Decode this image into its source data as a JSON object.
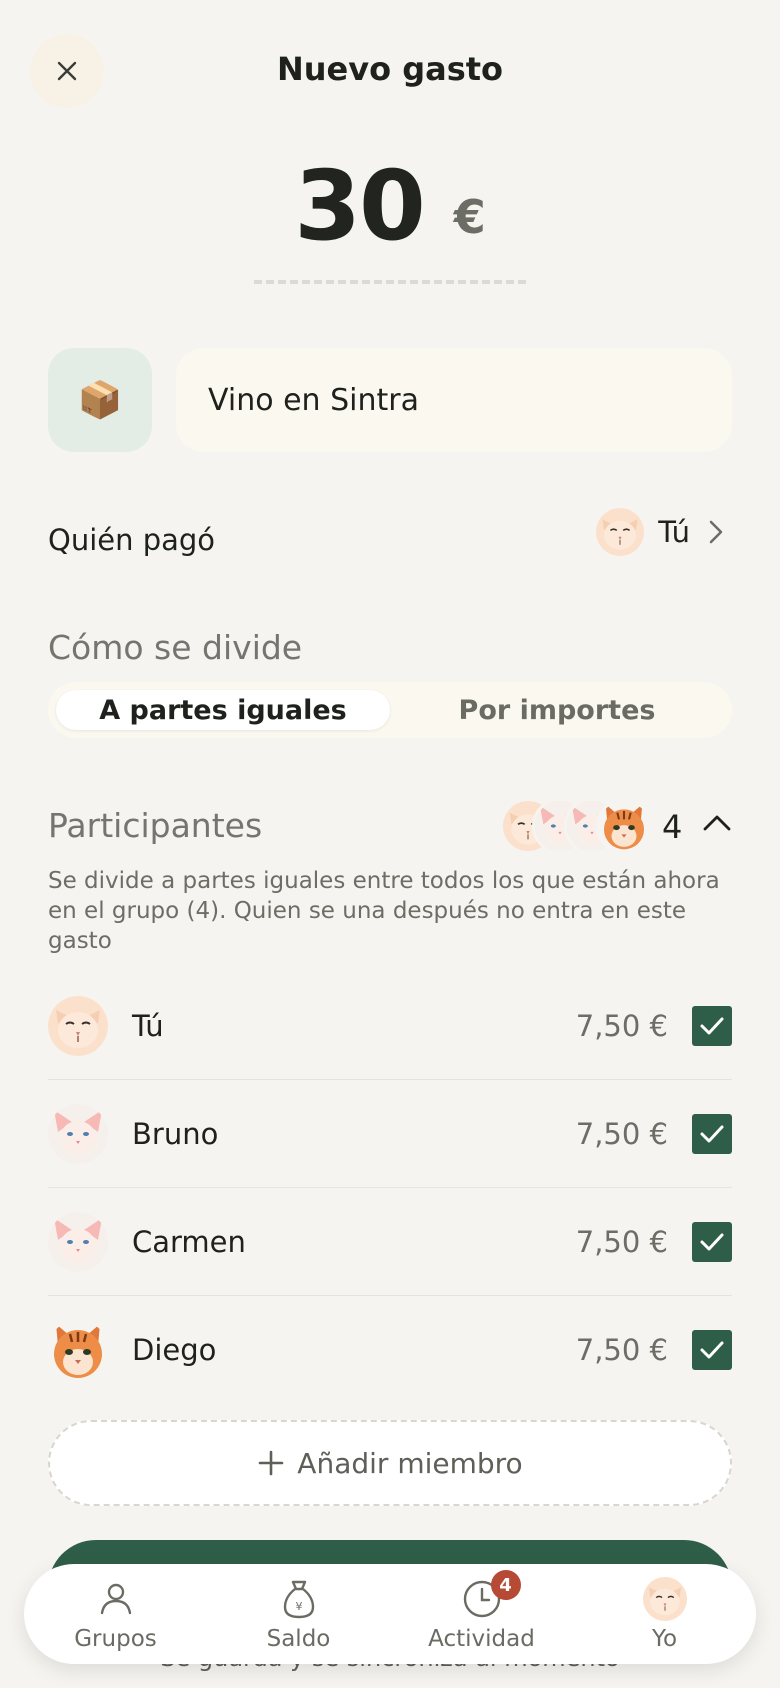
{
  "header": {
    "title": "Nuevo gasto"
  },
  "amount": {
    "value": "30",
    "currency": "€"
  },
  "expense": {
    "category_emoji": "📦",
    "description": "Vino en Sintra"
  },
  "payer": {
    "label": "Quién pagó",
    "name": "Tú"
  },
  "split": {
    "label": "Cómo se divide",
    "options": [
      "A partes iguales",
      "Por importes"
    ],
    "selected": "A partes iguales"
  },
  "participants": {
    "label": "Participantes",
    "count": "4",
    "description": "Se divide a partes iguales entre todos los que están ahora en el grupo (4). Quien se una después no entra en este gasto",
    "members": [
      {
        "name": "Tú",
        "amount": "7,50 €",
        "checked": true
      },
      {
        "name": "Bruno",
        "amount": "7,50 €",
        "checked": true
      },
      {
        "name": "Carmen",
        "amount": "7,50 €",
        "checked": true
      },
      {
        "name": "Diego",
        "amount": "7,50 €",
        "checked": true
      }
    ],
    "add_label": "Añadir miembro"
  },
  "footer": {
    "save_hint": "Se guarda y se sincroniza al momento"
  },
  "nav": {
    "items": [
      {
        "label": "Grupos",
        "icon": "users-icon"
      },
      {
        "label": "Saldo",
        "icon": "money-bag-icon"
      },
      {
        "label": "Actividad",
        "icon": "clock-icon",
        "badge": "4"
      },
      {
        "label": "Yo",
        "icon": "avatar"
      }
    ]
  },
  "colors": {
    "background": "#f6f4f0",
    "accent": "#2f5e48",
    "badge": "#b64a35",
    "field": "#fbf8f0"
  }
}
